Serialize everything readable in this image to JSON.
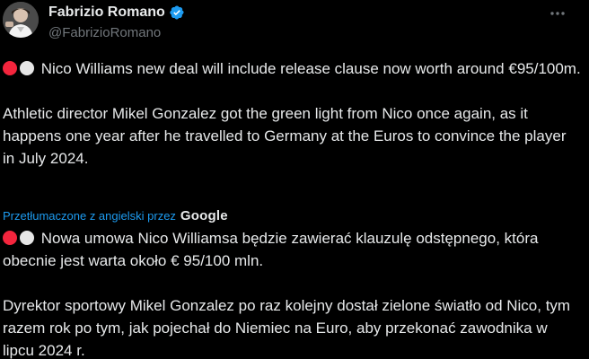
{
  "author": {
    "display_name": "Fabrizio Romano",
    "handle": "@FabrizioRomano",
    "verified_color": "#1d9bf0"
  },
  "menu": {
    "more_icon": "more-horizontal-icon"
  },
  "tweet": {
    "emoji": [
      "red-circle",
      "white-circle"
    ],
    "line1": "Nico Williams new deal will include release clause now worth around €95/100m.",
    "line2": "Athletic director Mikel Gonzalez got the green light from Nico once again, as it happens one year after he travelled to Germany at the Euros to convince the player in July 2024."
  },
  "translation": {
    "label": "Przetłumaczone z angielski przez",
    "provider": "Google",
    "line1": "Nowa umowa Nico Williamsa będzie zawierać klauzulę odstępnego, która obecnie jest warta około € 95/100 mln.",
    "line2": "Dyrektor sportowy Mikel Gonzalez po raz kolejny dostał zielone światło od Nico, tym razem rok po tym, jak pojechał do Niemiec na Euro, aby przekonać zawodnika w lipcu 2024 r."
  },
  "colors": {
    "background": "#000000",
    "text": "#e7e9ea",
    "secondary": "#71767b",
    "link": "#1d9bf0",
    "red_circle": "#f4253d",
    "white_circle": "#e6e6e6"
  }
}
